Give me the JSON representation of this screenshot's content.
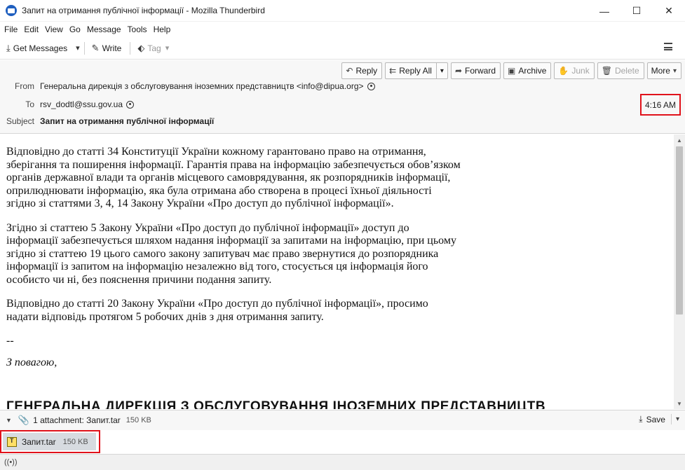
{
  "window": {
    "title": "Запит на отримання публічної інформації - Mozilla Thunderbird",
    "minimize": "—",
    "maximize": "☐",
    "close": "✕"
  },
  "menu": [
    "File",
    "Edit",
    "View",
    "Go",
    "Message",
    "Tools",
    "Help"
  ],
  "toolbar": {
    "get_messages": "Get Messages",
    "write": "Write",
    "tag": "Tag"
  },
  "actions": {
    "reply": "Reply",
    "reply_all": "Reply All",
    "forward": "Forward",
    "archive": "Archive",
    "junk": "Junk",
    "delete": "Delete",
    "more": "More"
  },
  "header": {
    "from_label": "From",
    "from_value": "Генеральна дирекція з обслуговування іноземних представництв <info@dipua.org>",
    "to_label": "To",
    "to_value": "rsv_dodtl@ssu.gov.ua",
    "subject_label": "Subject",
    "subject_value": "Запит на отримання публічної інформації",
    "time": "4:16 AM"
  },
  "body": {
    "paragraphs": [
      "Відповідно до статті 34 Конституції України кожному гарантовано право на отримання, зберігання та поширення інформації. Гарантія права на інформацію забезпечується обов’язком органів державної влади та органів місцевого самоврядування, як розпорядників інформації, оприлюднювати інформацію, яка була отримана або створена в процесі їхньої діяльності згідно зі статтями 3, 4, 14 Закону України «Про доступ до публічної інформації».",
      "Згідно зі статтею 5 Закону України «Про доступ до публічної інформації» доступ до інформації забезпечується шляхом надання інформації за запитами на інформацію, при цьому згідно зі статтею 19 цього самого закону запитувач має право звернутися до розпорядника інформації із запитом на інформацію незалежно від того, стосується ця інформація його особисто чи ні, без пояснення причини подання запиту.",
      "Відповідно до статті 20 Закону України «Про доступ до публічної інформації», просимо надати відповідь протягом 5 робочих днів з дня отримання запиту."
    ],
    "sig_dash": "--",
    "sig_regards": "З повагою,",
    "sig_org": "ГЕНЕРАЛЬНА ДИРЕКЦІЯ З ОБСЛУГОВУВАННЯ ІНОЗЕМНИХ ПРЕДСТАВНИЦТВ"
  },
  "attachments": {
    "summary": "1 attachment: Запит.tar",
    "summary_size": "150 KB",
    "save": "Save",
    "items": [
      {
        "name": "Запит.tar",
        "size": "150 KB"
      }
    ]
  },
  "status": {
    "activity_icon": "((•))"
  }
}
